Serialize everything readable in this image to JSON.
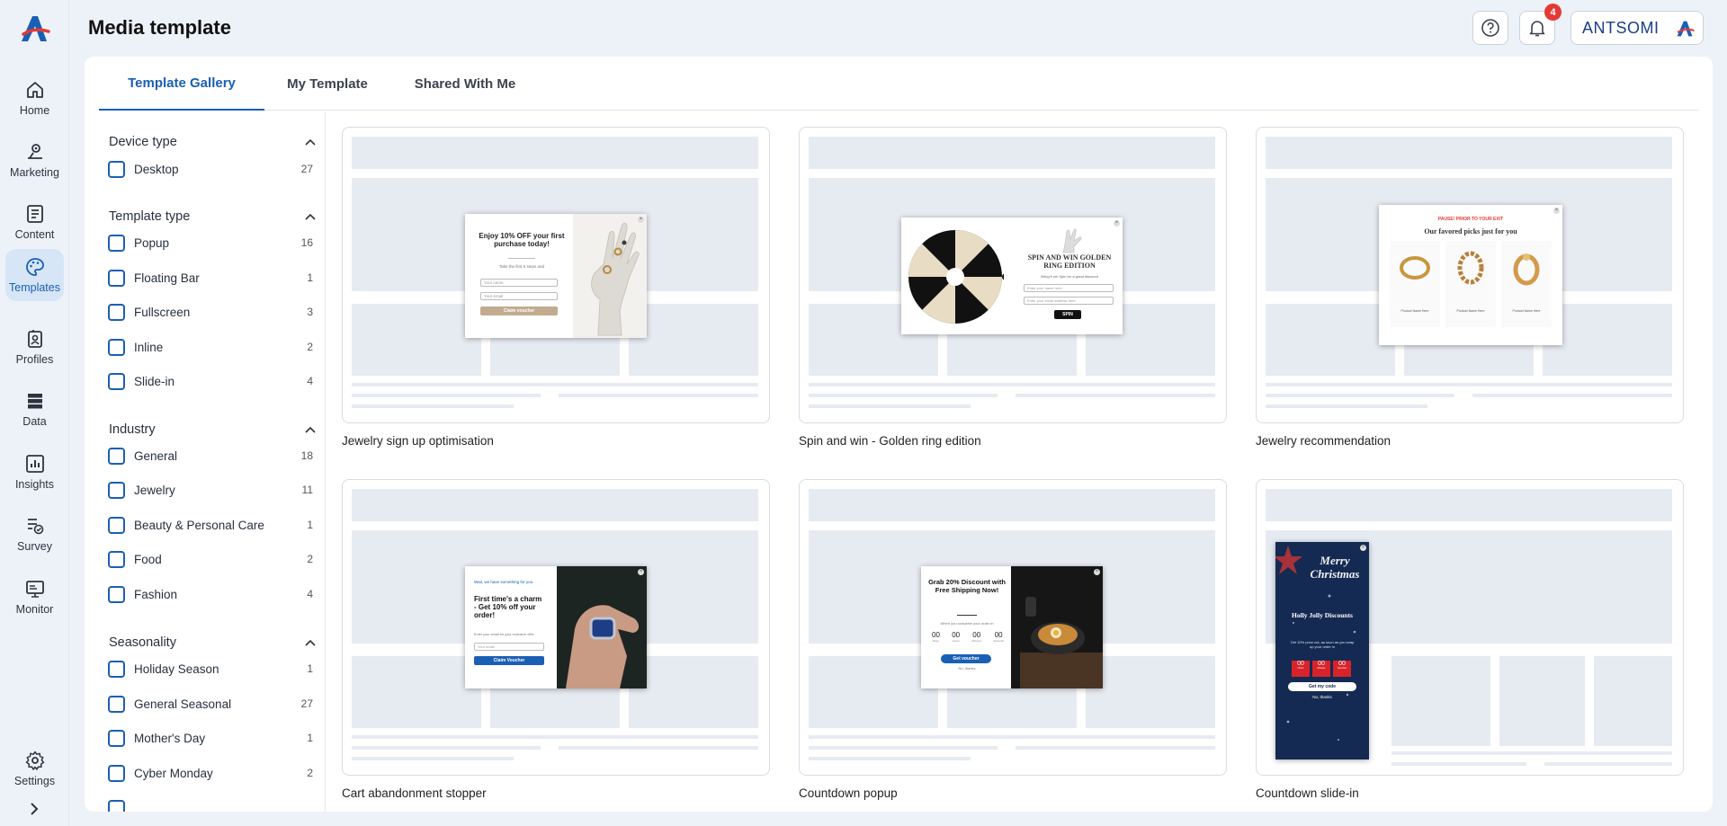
{
  "header": {
    "title": "Media template",
    "notification_count": "4",
    "brand": "ANTSOMI"
  },
  "nav": {
    "items": [
      {
        "label": "Home",
        "icon": "home-icon"
      },
      {
        "label": "Marketing",
        "icon": "marketing-icon"
      },
      {
        "label": "Content",
        "icon": "content-icon"
      },
      {
        "label": "Templates",
        "icon": "palette-icon",
        "active": true
      },
      {
        "label": "Profiles",
        "icon": "profile-icon"
      },
      {
        "label": "Data",
        "icon": "data-icon"
      },
      {
        "label": "Insights",
        "icon": "insights-icon"
      },
      {
        "label": "Survey",
        "icon": "survey-icon"
      },
      {
        "label": "Monitor",
        "icon": "monitor-icon"
      },
      {
        "label": "Settings",
        "icon": "gear-icon"
      }
    ]
  },
  "tabs": [
    {
      "label": "Template Gallery",
      "active": true
    },
    {
      "label": "My Template"
    },
    {
      "label": "Shared With Me"
    }
  ],
  "filters": [
    {
      "heading": "Device type",
      "options": [
        {
          "label": "Desktop",
          "count": "27"
        }
      ]
    },
    {
      "heading": "Template type",
      "options": [
        {
          "label": "Popup",
          "count": "16"
        },
        {
          "label": "Floating Bar",
          "count": "1"
        },
        {
          "label": "Fullscreen",
          "count": "3"
        },
        {
          "label": "Inline",
          "count": "2"
        },
        {
          "label": "Slide-in",
          "count": "4"
        }
      ]
    },
    {
      "heading": "Industry",
      "options": [
        {
          "label": "General",
          "count": "18"
        },
        {
          "label": "Jewelry",
          "count": "11"
        },
        {
          "label": "Beauty & Personal Care",
          "count": "1"
        },
        {
          "label": "Food",
          "count": "2"
        },
        {
          "label": "Fashion",
          "count": "4"
        }
      ]
    },
    {
      "heading": "Seasonality",
      "options": [
        {
          "label": "Holiday Season",
          "count": "1"
        },
        {
          "label": "General Seasonal",
          "count": "27"
        },
        {
          "label": "Mother's Day",
          "count": "1"
        },
        {
          "label": "Cyber Monday",
          "count": "2"
        }
      ]
    }
  ],
  "templates": [
    {
      "title": "Jewelry sign up optimisation",
      "preview": {
        "headline": "Enjoy 10% OFF your first purchase today!",
        "sub": "Take the first 5 steps and",
        "fields": [
          "Your name",
          "Your email"
        ],
        "button": "Claim voucher"
      }
    },
    {
      "title": "Spin and win - Golden ring edition",
      "preview": {
        "headline": "SPIN AND WIN GOLDEN RING EDITION",
        "sub": "Bring it on! Spin for a great discount",
        "fields": [
          "Enter your name here",
          "Enter your email address here"
        ],
        "button": "SPIN"
      }
    },
    {
      "title": "Jewelry recommendation",
      "preview": {
        "kicker": "PAUSE! PRIOR TO YOUR EXIT",
        "headline": "Our favored picks just for you",
        "products": [
          "Product Name Here",
          "Product Name Here",
          "Product Name Here"
        ]
      }
    },
    {
      "title": "Cart abandonment stopper",
      "preview": {
        "kicker": "Wait, we have something for you",
        "headline": "First time's a charm - Get 10% off your order!",
        "sub": "Enter your email for your exclusive offer",
        "fields": [
          "Your email"
        ],
        "button": "Claim Voucher"
      }
    },
    {
      "title": "Countdown popup",
      "preview": {
        "headline": "Grab 20% Discount with Free Shipping Now!",
        "sub": "When you complete your order in",
        "digits": [
          "00",
          "00",
          "00",
          "00"
        ],
        "units": [
          "Days",
          "Hours",
          "Minutes",
          "Seconds"
        ],
        "button": "Get voucher",
        "link": "No, thanks"
      }
    },
    {
      "title": "Countdown slide-in",
      "preview": {
        "headline": "Merry Christmas",
        "sub": "Holly Jolly Discounts",
        "body": "Get 10% price cut, as soon as you wrap up your order in",
        "digits": [
          "00",
          "00",
          "00"
        ],
        "units": [
          "Hours",
          "Minutes",
          "Seconds"
        ],
        "button": "Get my code",
        "link": "No, thanks"
      }
    }
  ],
  "colors": {
    "accent": "#1a5fb4",
    "badge": "#e53935",
    "sidebar_bg": "#edf2f8",
    "skeleton": "#e6ebf2"
  }
}
